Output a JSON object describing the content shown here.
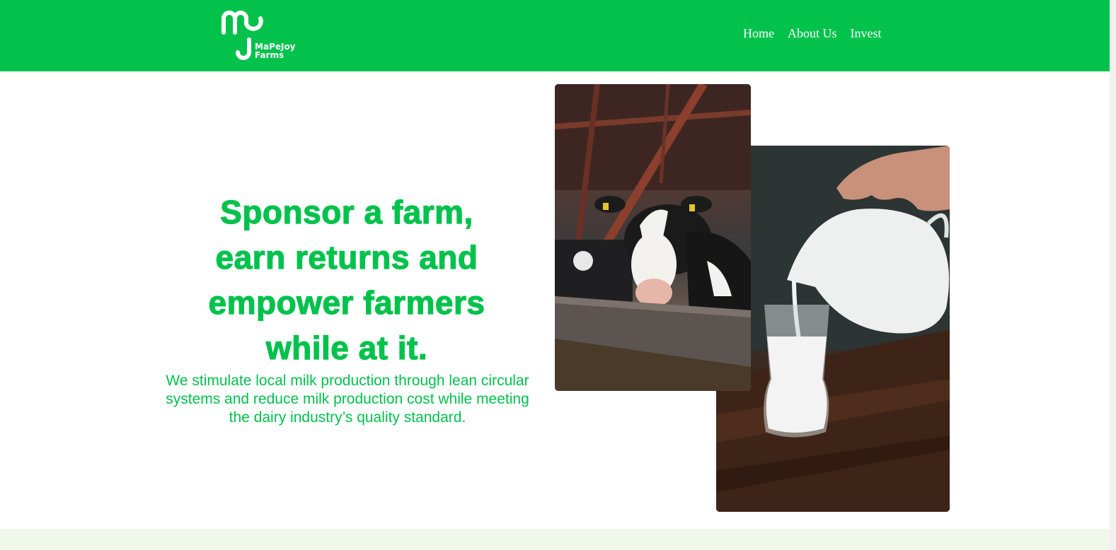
{
  "brand": {
    "name_line1": "MaPeJoy",
    "name_line2": "Farms",
    "color": "#02c24c"
  },
  "nav": {
    "items": [
      {
        "label": "Home"
      },
      {
        "label": "About Us"
      },
      {
        "label": "Invest"
      }
    ]
  },
  "hero": {
    "title_lines": [
      "Sponsor a farm,",
      "earn returns and",
      "empower farmers",
      "while at it."
    ],
    "subtitle_lines": [
      "We stimulate local milk production through lean circular",
      "systems and reduce milk production cost while meeting",
      "the dairy industry’s quality standard."
    ]
  },
  "images": {
    "cow": {
      "icon": "cow-in-barn-photo"
    },
    "milk": {
      "icon": "milk-pouring-photo"
    }
  },
  "colors": {
    "accent": "#02c24c",
    "band": "#f0f7eb"
  }
}
